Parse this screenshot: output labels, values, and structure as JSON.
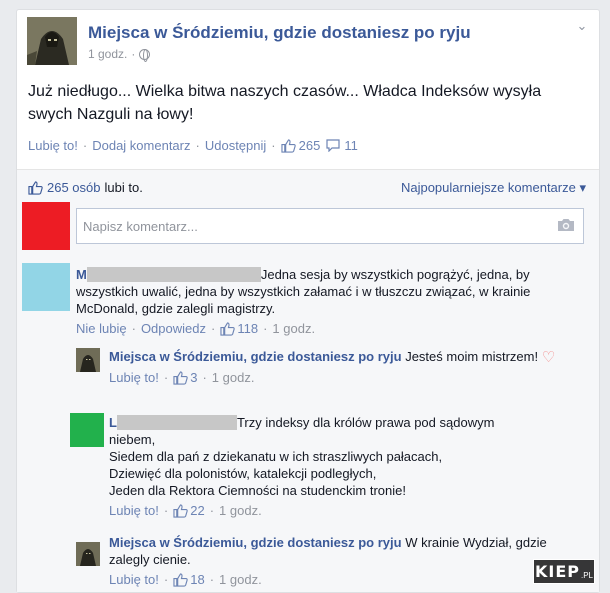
{
  "post": {
    "page_name": "Miejsca w Śródziemiu, gdzie dostaniesz po ryju",
    "time": "1 godz.",
    "separator": "·",
    "text": "Już niedługo... Wielka bitwa naszych czasów... Władca Indeksów wysyła swych Nazguli na łowy!",
    "actions": {
      "like": "Lubię to!",
      "comment": "Dodaj komentarz",
      "share": "Udostępnij",
      "like_count": "265",
      "comment_count": "11"
    },
    "icons": [
      "gear-icon",
      "globe-icon",
      "chevron-down-icon",
      "thumb-icon",
      "comment-bubble-icon"
    ]
  },
  "comments_section": {
    "likes_count": "265 osób",
    "likes_suffix": "lubi to.",
    "sort_label": "Najpopularniejsze komentarze",
    "sort_arrow": "▾",
    "input_placeholder": "Napisz komentarz..."
  },
  "comments": [
    {
      "author_initial": "M",
      "text_line1": "Jedna sesja by wszystkich pogrążyć, jedna, by",
      "text_rest": "wszystkich uwalić, jedna by wszystkich załamać i w tłuszczu związać, w krainie McDonald, gdzie zalegli magistrzy.",
      "actions": {
        "unlike": "Nie lubię",
        "reply": "Odpowiedz",
        "likes": "118",
        "time": "1 godz."
      },
      "avatar_color": "#92d5e6"
    }
  ],
  "replies": [
    {
      "author": "Miejsca w Śródziemiu, gdzie dostaniesz po ryju",
      "text": "Jesteś moim mistrzem!",
      "actions": {
        "like": "Lubię to!",
        "likes": "3",
        "time": "1 godz."
      }
    },
    {
      "author_initial": "L",
      "text_line1": "Trzy indeksy dla królów prawa pod sądowym",
      "text_line2": "niebem,",
      "text_line3": "Siedem dla pań z dziekanatu w ich straszliwych pałacach,",
      "text_line4": "Dziewięć dla polonistów, katalekcji podległych,",
      "text_line5": "Jeden dla Rektora Ciemności na studenckim tronie!",
      "actions": {
        "like": "Lubię to!",
        "likes": "22",
        "time": "1 godz."
      },
      "avatar_color": "#22b14c"
    },
    {
      "author": "Miejsca w Śródziemiu, gdzie dostaniesz po ryju",
      "text": "W krainie Wydział, gdzie zalegly cienie.",
      "actions": {
        "like": "Lubię to!",
        "likes": "18",
        "time": "1 godz."
      }
    }
  ],
  "watermark": {
    "main": "KIEP",
    "suffix": ".PL"
  },
  "colors": {
    "link": "#3b5998",
    "action": "#6d84b4",
    "muted": "#90949c",
    "my_avatar": "#ed1c24"
  }
}
